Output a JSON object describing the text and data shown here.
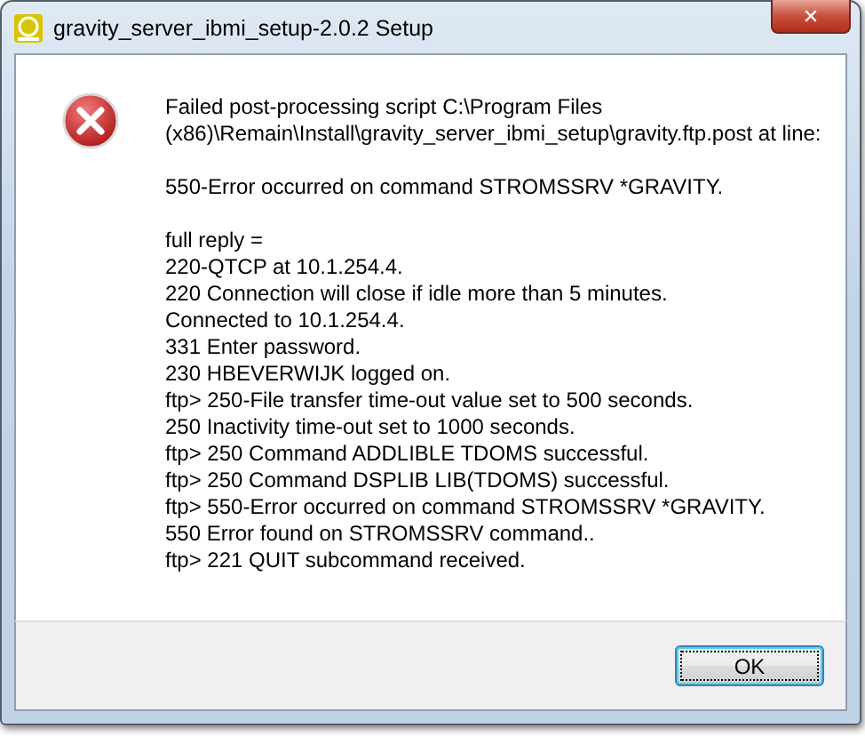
{
  "window": {
    "title": "gravity_server_ibmi_setup-2.0.2 Setup",
    "close": "✕"
  },
  "message": {
    "paragraphs": [
      [
        "Failed post-processing script C:\\Program Files",
        "(x86)\\Remain\\Install\\gravity_server_ibmi_setup\\gravity.ftp.post at line:"
      ],
      [
        "550-Error occurred on command STROMSSRV *GRAVITY."
      ],
      [
        "full reply =",
        "220-QTCP at 10.1.254.4.",
        "220 Connection will close if idle more than 5 minutes.",
        "Connected to 10.1.254.4.",
        "331 Enter password.",
        "230 HBEVERWIJK logged on.",
        "ftp> 250-File transfer time-out value set to 500 seconds.",
        "250 Inactivity time-out set to 1000 seconds.",
        "ftp> 250 Command ADDLIBLE TDOMS successful.",
        "ftp> 250 Command DSPLIB LIB(TDOMS) successful.",
        "ftp> 550-Error occurred on command STROMSSRV *GRAVITY.",
        "550 Error found on STROMSSRV command..",
        "ftp> 221 QUIT subcommand received."
      ]
    ]
  },
  "buttons": [
    {
      "label": "OK",
      "selected": true
    }
  ]
}
